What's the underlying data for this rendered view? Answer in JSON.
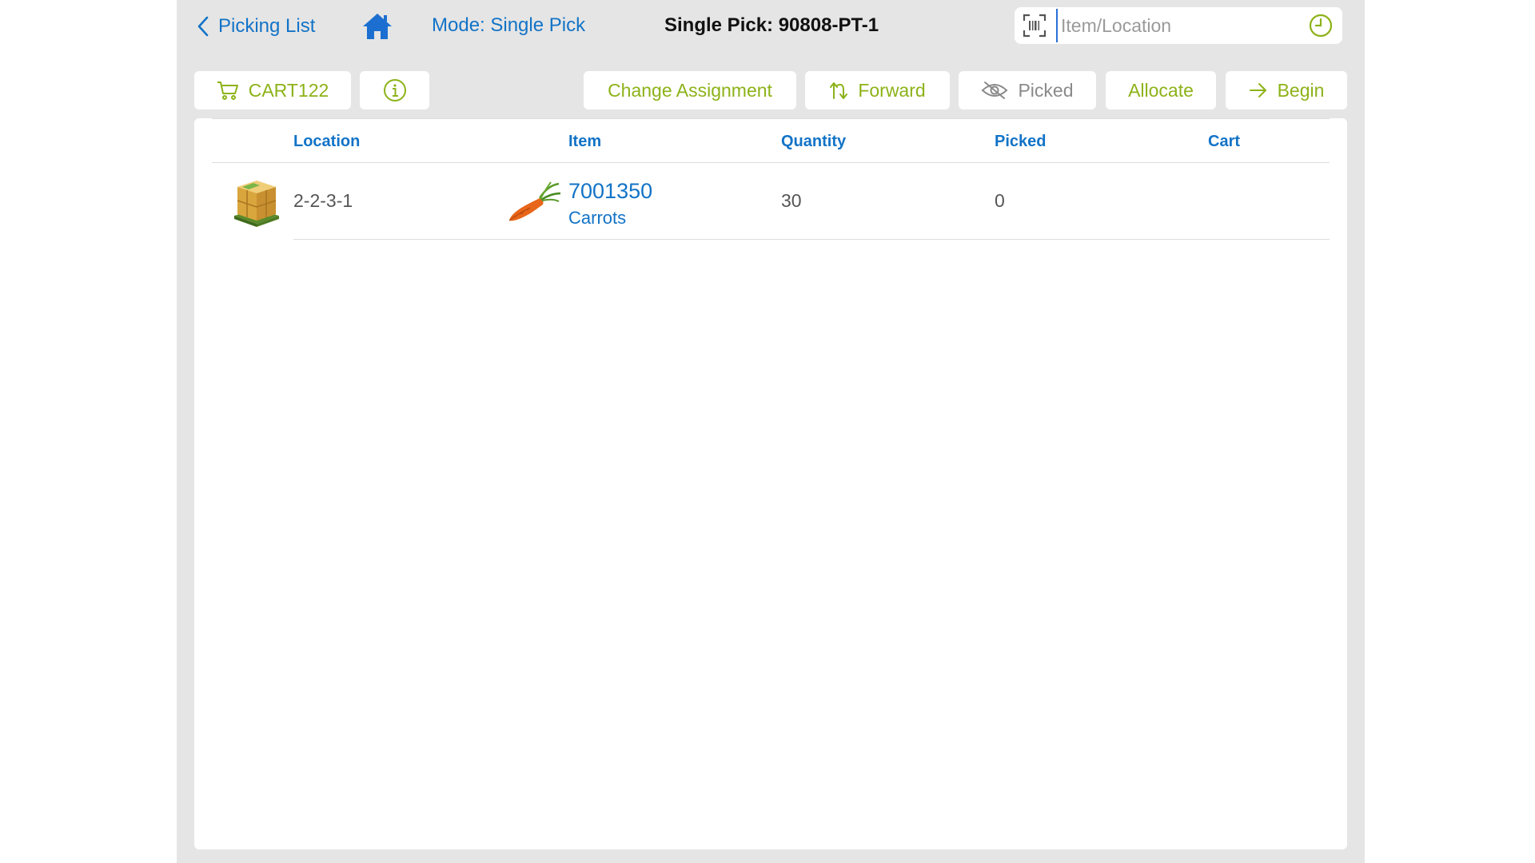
{
  "nav": {
    "back_label": "Picking List",
    "mode_label": "Mode: Single Pick",
    "title": "Single Pick: 90808-PT-1"
  },
  "search": {
    "placeholder": "Item/Location",
    "value": ""
  },
  "toolbar": {
    "cart_label": "CART122",
    "change_assignment_label": "Change Assignment",
    "forward_label": "Forward",
    "picked_label": "Picked",
    "allocate_label": "Allocate",
    "begin_label": "Begin"
  },
  "table": {
    "headers": {
      "location": "Location",
      "item": "Item",
      "quantity": "Quantity",
      "picked": "Picked",
      "cart": "Cart"
    },
    "rows": [
      {
        "location": "2-2-3-1",
        "item_code": "7001350",
        "item_name": "Carrots",
        "quantity": "30",
        "picked": "0",
        "cart": "",
        "location_icon": "pallet-boxes-icon",
        "item_icon": "carrot-icon"
      }
    ]
  },
  "colors": {
    "accent_blue": "#1273c7",
    "accent_green": "#8db218",
    "background": "#e5e5e5"
  }
}
